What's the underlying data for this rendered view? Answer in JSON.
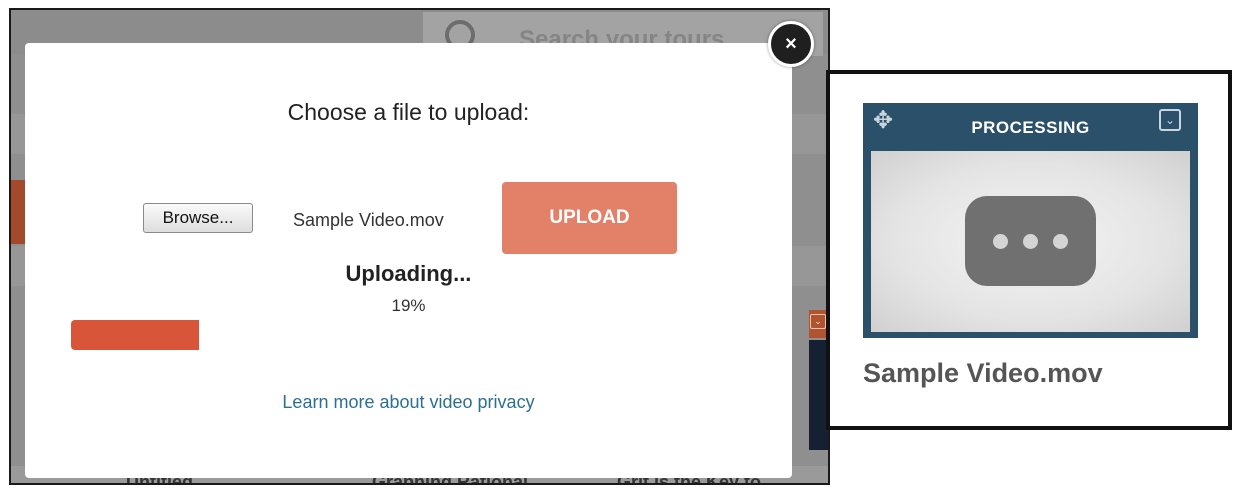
{
  "background": {
    "search_placeholder": "Search your tours",
    "tour_titles": [
      "Untitled",
      "Graphing Rational",
      "Grit is the Key to"
    ]
  },
  "modal": {
    "title": "Choose a file to upload:",
    "browse_label": "Browse...",
    "file_name": "Sample Video.mov",
    "upload_label": "UPLOAD",
    "status_text": "Uploading...",
    "percent_text": "19%",
    "progress_fraction": 0.19,
    "privacy_link": "Learn more about video privacy",
    "close_label": "×"
  },
  "card": {
    "status": "PROCESSING",
    "file_name": "Sample Video.mov"
  },
  "colors": {
    "upload_button": "#e28068",
    "progress_fill": "#d9553a",
    "link": "#2d6e93",
    "card_header": "#2b5069"
  }
}
